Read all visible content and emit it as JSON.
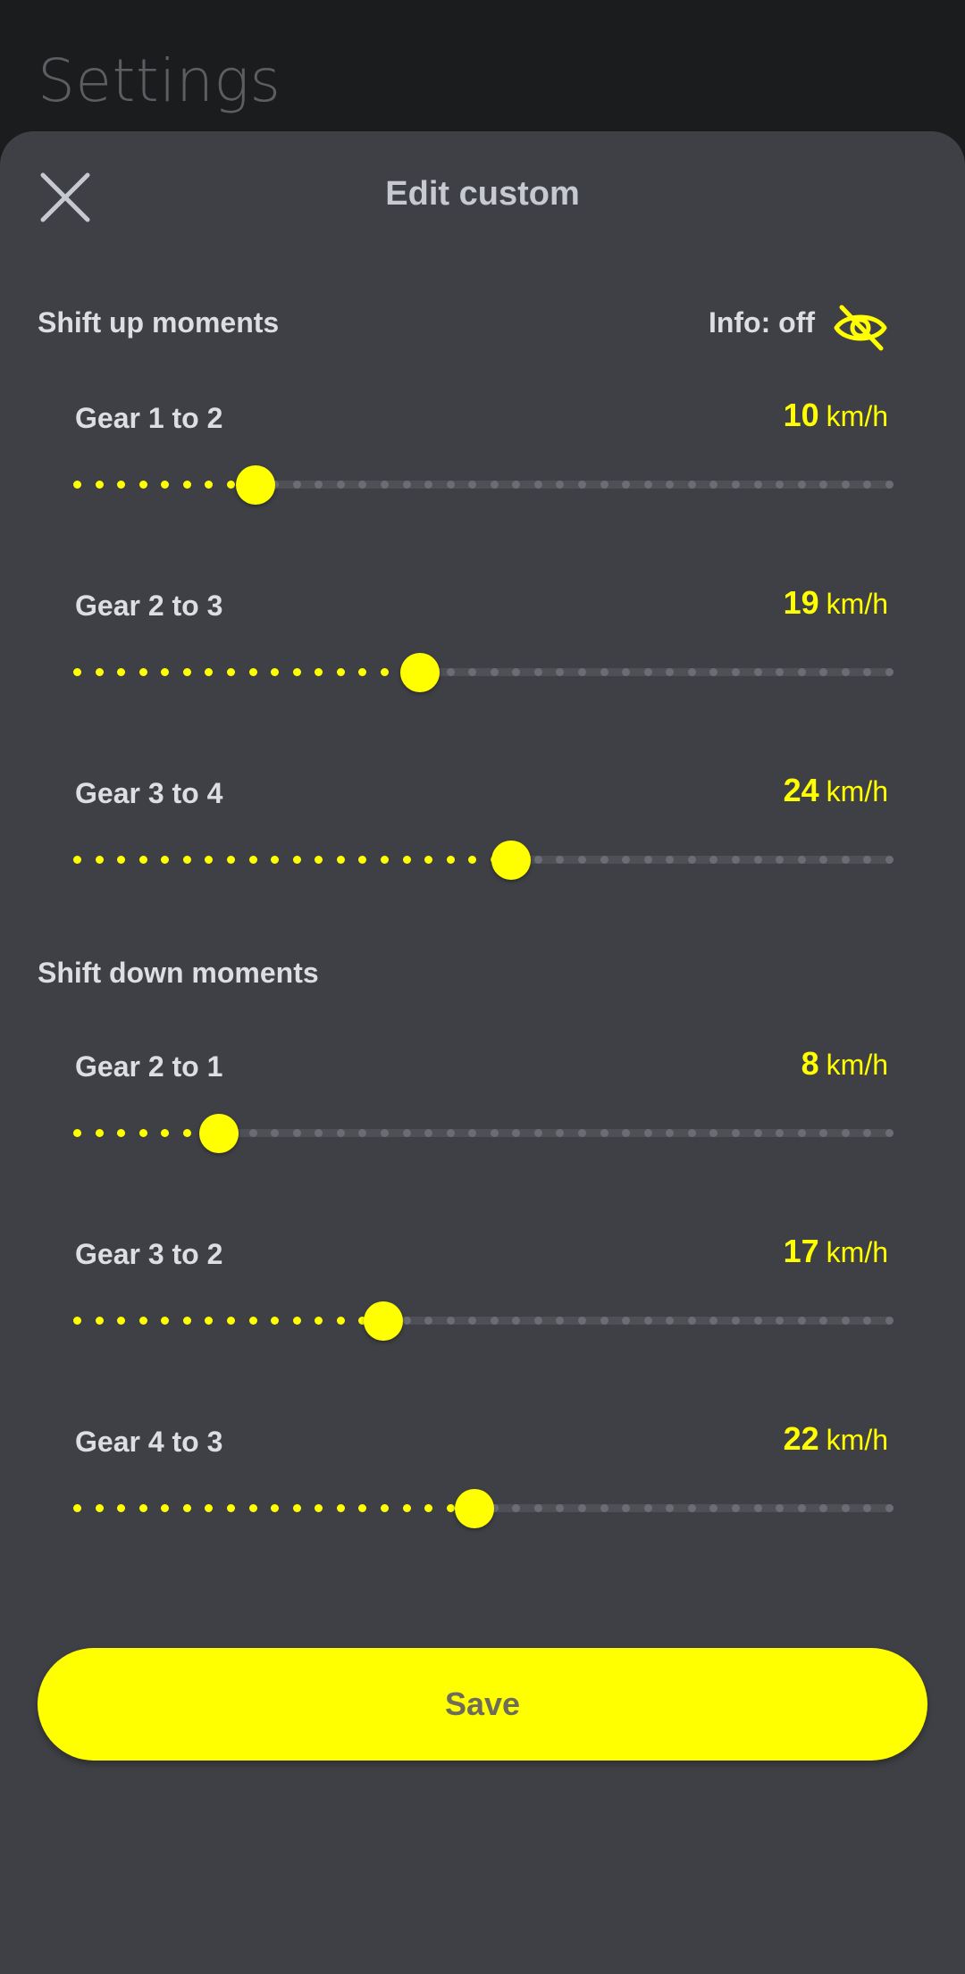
{
  "background_title": "Settings",
  "sheet": {
    "title": "Edit custom",
    "close_icon": "close-icon",
    "info_label": "Info: off",
    "info_icon": "eye-off-icon"
  },
  "colors": {
    "accent": "#ffff00",
    "sheet_bg": "#3e4045",
    "page_bg": "#1b1c1e"
  },
  "slider_range": {
    "min": 0,
    "max": 45
  },
  "shift_up": {
    "title": "Shift up moments",
    "gears": [
      {
        "label": "Gear 1 to 2",
        "value": "10",
        "unit": "km/h"
      },
      {
        "label": "Gear 2 to 3",
        "value": "19",
        "unit": "km/h"
      },
      {
        "label": "Gear 3 to 4",
        "value": "24",
        "unit": "km/h"
      }
    ]
  },
  "shift_down": {
    "title": "Shift down moments",
    "gears": [
      {
        "label": "Gear 2 to 1",
        "value": "8",
        "unit": "km/h"
      },
      {
        "label": "Gear 3 to 2",
        "value": "17",
        "unit": "km/h"
      },
      {
        "label": "Gear 4 to 3",
        "value": "22",
        "unit": "km/h"
      }
    ]
  },
  "save_label": "Save"
}
